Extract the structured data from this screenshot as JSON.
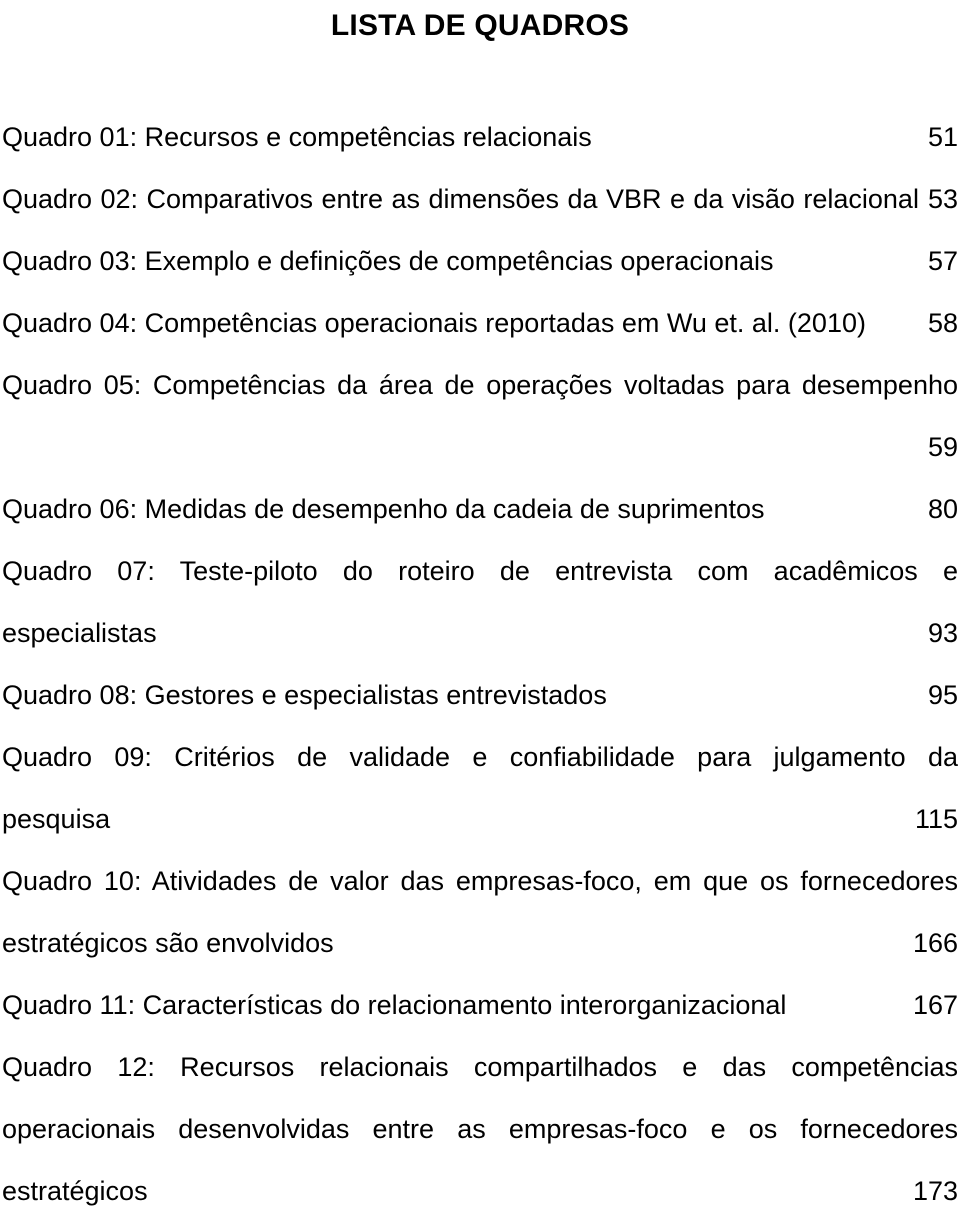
{
  "document": {
    "title": "LISTA DE QUADROS",
    "language": "pt-BR"
  },
  "entries": [
    {
      "id": "quadro-01",
      "label": "Quadro 01:",
      "caption": "Recursos e competências relacionais",
      "full_text": "Quadro 01: Recursos e competências relacionais",
      "page": "51",
      "lines": [
        {
          "text": "Quadro 01: Recursos e competências relacionais",
          "leader": true,
          "page": "51"
        }
      ]
    },
    {
      "id": "quadro-02",
      "label": "Quadro 02:",
      "caption": "Comparativos entre as dimensões da VBR e da visão relacional",
      "full_text": "Quadro 02: Comparativos entre as dimensões da VBR e da visão relacional",
      "page": "53",
      "lines": [
        {
          "text": "Quadro 02: Comparativos entre as dimensões da VBR e da visão relacional .",
          "leader": false,
          "page": "53"
        }
      ]
    },
    {
      "id": "quadro-03",
      "label": "Quadro 03:",
      "caption": "Exemplo e definições de competências operacionais",
      "full_text": "Quadro 03: Exemplo e definições de competências operacionais",
      "page": "57",
      "lines": [
        {
          "text": "Quadro 03: Exemplo e definições de competências operacionais",
          "leader": true,
          "page": "57"
        }
      ]
    },
    {
      "id": "quadro-04",
      "label": "Quadro 04:",
      "caption": "Competências operacionais reportadas em Wu et. al. (2010)",
      "full_text": "Quadro 04: Competências operacionais reportadas em Wu et. al. (2010)",
      "page": "58",
      "lines": [
        {
          "text": "Quadro 04: Competências operacionais reportadas em Wu et. al. (2010)",
          "leader": true,
          "page": "58"
        }
      ]
    },
    {
      "id": "quadro-05",
      "label": "Quadro 05:",
      "caption": "Competências da área de operações voltadas para desempenho",
      "full_text": "Quadro 05: Competências da área de operações voltadas para desempenho",
      "page": "59",
      "lines": [
        {
          "text": "Quadro 05:  Competências  da  área  de  operações  voltadas  para  desempenho",
          "leader": false,
          "page": "",
          "justify": true
        },
        {
          "text": "",
          "leader": true,
          "page": "59"
        }
      ]
    },
    {
      "id": "quadro-06",
      "label": "Quadro 06:",
      "caption": "Medidas de desempenho da cadeia de suprimentos",
      "full_text": "Quadro 06: Medidas de desempenho da cadeia de suprimentos",
      "page": "80",
      "lines": [
        {
          "text": "Quadro 06: Medidas de desempenho da cadeia de suprimentos",
          "leader": true,
          "page": "80"
        }
      ]
    },
    {
      "id": "quadro-07",
      "label": "Quadro 07:",
      "caption": "Teste-piloto do roteiro de entrevista com acadêmicos e especialistas",
      "full_text": "Quadro 07: Teste-piloto do roteiro de entrevista com acadêmicos e especialistas",
      "page": "93",
      "lines": [
        {
          "text": "Quadro  07:  Teste-piloto  do  roteiro  de  entrevista  com  acadêmicos  e",
          "leader": false,
          "page": "",
          "justify": true
        },
        {
          "text": "especialistas",
          "leader": true,
          "page": "93"
        }
      ]
    },
    {
      "id": "quadro-08",
      "label": "Quadro 08:",
      "caption": "Gestores e especialistas entrevistados",
      "full_text": "Quadro 08: Gestores e especialistas entrevistados",
      "page": "95",
      "lines": [
        {
          "text": "Quadro 08: Gestores e especialistas entrevistados",
          "leader": true,
          "page": "95"
        }
      ]
    },
    {
      "id": "quadro-09",
      "label": "Quadro 09:",
      "caption": "Critérios de validade e confiabilidade para julgamento da pesquisa",
      "full_text": "Quadro 09: Critérios de validade e confiabilidade para julgamento da pesquisa",
      "page": "115",
      "lines": [
        {
          "text": "Quadro  09:  Critérios  de  validade  e  confiabilidade  para  julgamento  da",
          "leader": false,
          "page": "",
          "justify": true
        },
        {
          "text": "pesquisa",
          "leader": true,
          "page": "115"
        }
      ]
    },
    {
      "id": "quadro-10",
      "label": "Quadro 10:",
      "caption": "Atividades de valor das empresas-foco, em que os fornecedores estratégicos são envolvidos",
      "full_text": "Quadro 10: Atividades de valor das empresas-foco, em que os fornecedores estratégicos são envolvidos",
      "page": "166",
      "lines": [
        {
          "text": "Quadro 10: Atividades de valor das empresas-foco, em que os fornecedores",
          "leader": false,
          "page": "",
          "justify": true
        },
        {
          "text": "estratégicos são envolvidos",
          "leader": true,
          "page": "166"
        }
      ]
    },
    {
      "id": "quadro-11",
      "label": "Quadro 11:",
      "caption": "Características do relacionamento interorganizacional",
      "full_text": "Quadro 11: Características do relacionamento interorganizacional",
      "page": "167",
      "lines": [
        {
          "text": "Quadro 11: Características do relacionamento interorganizacional",
          "leader": true,
          "page": "167"
        }
      ]
    },
    {
      "id": "quadro-12",
      "label": "Quadro 12:",
      "caption": "Recursos relacionais compartilhados e das competências operacionais desenvolvidas entre as empresas-foco e os fornecedores estratégicos",
      "full_text": "Quadro 12: Recursos relacionais compartilhados e das competências operacionais desenvolvidas entre as empresas-foco e os fornecedores estratégicos",
      "page": "173",
      "lines": [
        {
          "text": "Quadro  12:  Recursos  relacionais  compartilhados  e  das  competências",
          "leader": false,
          "page": "",
          "justify": true
        },
        {
          "text": "operacionais  desenvolvidas  entre  as  empresas-foco  e  os  fornecedores",
          "leader": false,
          "page": "",
          "justify": true
        },
        {
          "text": "estratégicos",
          "leader": true,
          "page": "173"
        }
      ]
    }
  ]
}
